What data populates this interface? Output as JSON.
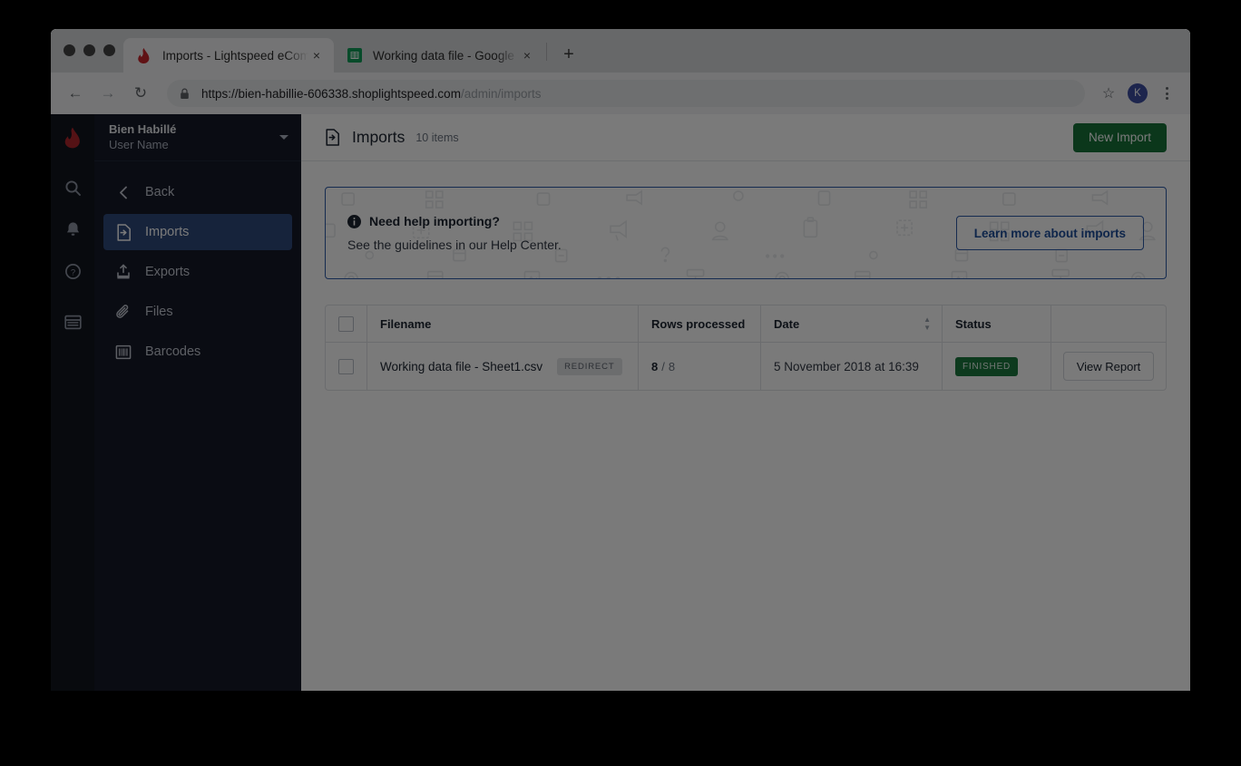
{
  "browser": {
    "tabs": [
      {
        "title": "Imports - Lightspeed eCom",
        "favicon": "lightspeed-flame-icon",
        "close": "×",
        "active": true
      },
      {
        "title": "Working data file - Google She",
        "favicon": "google-sheets-icon",
        "close": "×",
        "active": false
      }
    ],
    "new_tab_label": "+",
    "back_icon": "←",
    "forward_icon": "→",
    "reload_icon": "↻",
    "url_secure_prefix": "https://bien-habillie-606338.shoplightspeed.com",
    "url_path": "/admin/imports",
    "star_icon": "☆",
    "profile_initial": "K"
  },
  "rail": {
    "logo": "lightspeed-logo",
    "icons": [
      "search-icon",
      "notifications-icon",
      "help-icon",
      "browser-icon"
    ]
  },
  "sidebar": {
    "shop_name": "Bien Habillé",
    "user_name": "User Name",
    "items": [
      {
        "label": "Back",
        "icon": "chevron-left-icon",
        "active": false
      },
      {
        "label": "Imports",
        "icon": "import-icon",
        "active": true
      },
      {
        "label": "Exports",
        "icon": "export-icon",
        "active": false
      },
      {
        "label": "Files",
        "icon": "paperclip-icon",
        "active": false
      },
      {
        "label": "Barcodes",
        "icon": "barcode-icon",
        "active": false
      }
    ]
  },
  "page": {
    "title": "Imports",
    "icon": "import-icon",
    "item_count": "10 items",
    "new_import_label": "New Import"
  },
  "banner": {
    "title": "Need help importing?",
    "subtitle": "See the guidelines in our Help Center.",
    "button_label": "Learn more about imports",
    "info_icon": "info-icon"
  },
  "table": {
    "columns": [
      "Filename",
      "Rows processed",
      "Date",
      "Status"
    ],
    "sort_column": "Date",
    "rows": [
      {
        "filename": "Working data file - Sheet1.csv",
        "tag": "REDIRECT",
        "rows_done": "8",
        "rows_sep": "/",
        "rows_total": "8",
        "date": "5 November 2018 at 16:39",
        "status": "FINISHED",
        "action_label": "View Report"
      }
    ]
  },
  "colors": {
    "accent_green": "#17733a",
    "accent_blue": "#2c5aa8",
    "status_green": "#1d7a40",
    "sidebar_dark": "#161b28",
    "rail_dark": "#11151f",
    "nav_active": "#2f4a7c"
  }
}
